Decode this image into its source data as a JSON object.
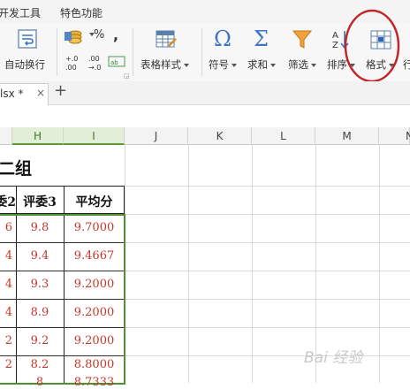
{
  "menu": {
    "items": [
      "开发工具",
      "特色功能"
    ]
  },
  "ribbon": {
    "wrap_text_label": "自动换行",
    "number_format": {
      "currency": "¥",
      "percent": "%",
      "comma": "⁹",
      "inc_decimal": ".0\n.00",
      "dec_decimal": ".00\n.0"
    },
    "table_style_label": "表格样式",
    "symbol_label": "符号",
    "sum_label": "求和",
    "filter_label": "筛选",
    "sort_label": "排序",
    "format_label": "格式",
    "row_col_label": "行"
  },
  "tab": {
    "filename": "lsx *",
    "close": "×",
    "add": "+"
  },
  "columns": [
    "H",
    "I",
    "J",
    "K",
    "L",
    "M",
    "N"
  ],
  "sheet": {
    "title": "二组",
    "headers": [
      "委2",
      "评委3",
      "平均分"
    ],
    "rows": [
      [
        "6",
        "9.8",
        "9.7000"
      ],
      [
        "4",
        "9.4",
        "9.4667"
      ],
      [
        "4",
        "9.3",
        "9.2000"
      ],
      [
        "4",
        "8.9",
        "9.2000"
      ],
      [
        "2",
        "9.2",
        "9.2000"
      ],
      [
        "2",
        "8.2",
        "8.8000"
      ],
      [
        "",
        "8",
        "8.7333"
      ]
    ]
  },
  "watermark": "Bai 经验"
}
